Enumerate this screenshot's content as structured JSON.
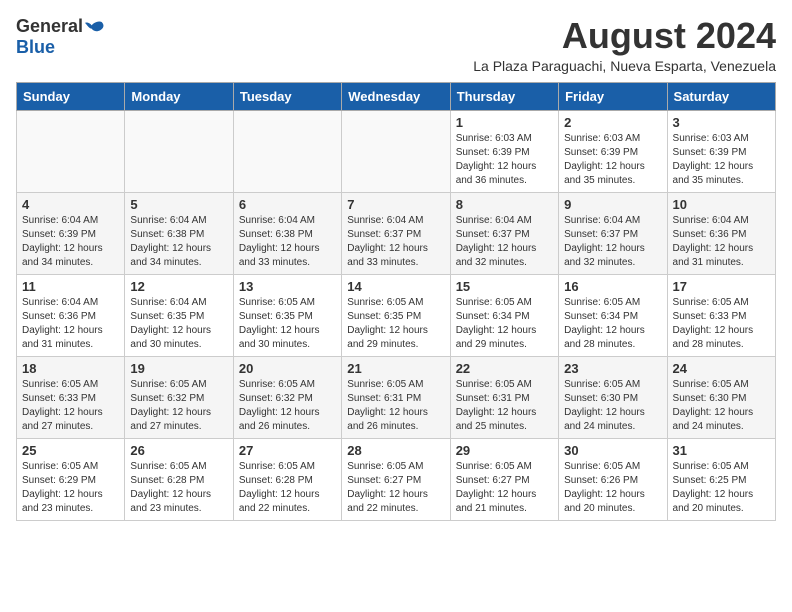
{
  "header": {
    "logo_general": "General",
    "logo_blue": "Blue",
    "month_title": "August 2024",
    "subtitle": "La Plaza Paraguachi, Nueva Esparta, Venezuela"
  },
  "weekdays": [
    "Sunday",
    "Monday",
    "Tuesday",
    "Wednesday",
    "Thursday",
    "Friday",
    "Saturday"
  ],
  "weeks": [
    [
      {
        "day": "",
        "info": ""
      },
      {
        "day": "",
        "info": ""
      },
      {
        "day": "",
        "info": ""
      },
      {
        "day": "",
        "info": ""
      },
      {
        "day": "1",
        "info": "Sunrise: 6:03 AM\nSunset: 6:39 PM\nDaylight: 12 hours\nand 36 minutes."
      },
      {
        "day": "2",
        "info": "Sunrise: 6:03 AM\nSunset: 6:39 PM\nDaylight: 12 hours\nand 35 minutes."
      },
      {
        "day": "3",
        "info": "Sunrise: 6:03 AM\nSunset: 6:39 PM\nDaylight: 12 hours\nand 35 minutes."
      }
    ],
    [
      {
        "day": "4",
        "info": "Sunrise: 6:04 AM\nSunset: 6:39 PM\nDaylight: 12 hours\nand 34 minutes."
      },
      {
        "day": "5",
        "info": "Sunrise: 6:04 AM\nSunset: 6:38 PM\nDaylight: 12 hours\nand 34 minutes."
      },
      {
        "day": "6",
        "info": "Sunrise: 6:04 AM\nSunset: 6:38 PM\nDaylight: 12 hours\nand 33 minutes."
      },
      {
        "day": "7",
        "info": "Sunrise: 6:04 AM\nSunset: 6:37 PM\nDaylight: 12 hours\nand 33 minutes."
      },
      {
        "day": "8",
        "info": "Sunrise: 6:04 AM\nSunset: 6:37 PM\nDaylight: 12 hours\nand 32 minutes."
      },
      {
        "day": "9",
        "info": "Sunrise: 6:04 AM\nSunset: 6:37 PM\nDaylight: 12 hours\nand 32 minutes."
      },
      {
        "day": "10",
        "info": "Sunrise: 6:04 AM\nSunset: 6:36 PM\nDaylight: 12 hours\nand 31 minutes."
      }
    ],
    [
      {
        "day": "11",
        "info": "Sunrise: 6:04 AM\nSunset: 6:36 PM\nDaylight: 12 hours\nand 31 minutes."
      },
      {
        "day": "12",
        "info": "Sunrise: 6:04 AM\nSunset: 6:35 PM\nDaylight: 12 hours\nand 30 minutes."
      },
      {
        "day": "13",
        "info": "Sunrise: 6:05 AM\nSunset: 6:35 PM\nDaylight: 12 hours\nand 30 minutes."
      },
      {
        "day": "14",
        "info": "Sunrise: 6:05 AM\nSunset: 6:35 PM\nDaylight: 12 hours\nand 29 minutes."
      },
      {
        "day": "15",
        "info": "Sunrise: 6:05 AM\nSunset: 6:34 PM\nDaylight: 12 hours\nand 29 minutes."
      },
      {
        "day": "16",
        "info": "Sunrise: 6:05 AM\nSunset: 6:34 PM\nDaylight: 12 hours\nand 28 minutes."
      },
      {
        "day": "17",
        "info": "Sunrise: 6:05 AM\nSunset: 6:33 PM\nDaylight: 12 hours\nand 28 minutes."
      }
    ],
    [
      {
        "day": "18",
        "info": "Sunrise: 6:05 AM\nSunset: 6:33 PM\nDaylight: 12 hours\nand 27 minutes."
      },
      {
        "day": "19",
        "info": "Sunrise: 6:05 AM\nSunset: 6:32 PM\nDaylight: 12 hours\nand 27 minutes."
      },
      {
        "day": "20",
        "info": "Sunrise: 6:05 AM\nSunset: 6:32 PM\nDaylight: 12 hours\nand 26 minutes."
      },
      {
        "day": "21",
        "info": "Sunrise: 6:05 AM\nSunset: 6:31 PM\nDaylight: 12 hours\nand 26 minutes."
      },
      {
        "day": "22",
        "info": "Sunrise: 6:05 AM\nSunset: 6:31 PM\nDaylight: 12 hours\nand 25 minutes."
      },
      {
        "day": "23",
        "info": "Sunrise: 6:05 AM\nSunset: 6:30 PM\nDaylight: 12 hours\nand 24 minutes."
      },
      {
        "day": "24",
        "info": "Sunrise: 6:05 AM\nSunset: 6:30 PM\nDaylight: 12 hours\nand 24 minutes."
      }
    ],
    [
      {
        "day": "25",
        "info": "Sunrise: 6:05 AM\nSunset: 6:29 PM\nDaylight: 12 hours\nand 23 minutes."
      },
      {
        "day": "26",
        "info": "Sunrise: 6:05 AM\nSunset: 6:28 PM\nDaylight: 12 hours\nand 23 minutes."
      },
      {
        "day": "27",
        "info": "Sunrise: 6:05 AM\nSunset: 6:28 PM\nDaylight: 12 hours\nand 22 minutes."
      },
      {
        "day": "28",
        "info": "Sunrise: 6:05 AM\nSunset: 6:27 PM\nDaylight: 12 hours\nand 22 minutes."
      },
      {
        "day": "29",
        "info": "Sunrise: 6:05 AM\nSunset: 6:27 PM\nDaylight: 12 hours\nand 21 minutes."
      },
      {
        "day": "30",
        "info": "Sunrise: 6:05 AM\nSunset: 6:26 PM\nDaylight: 12 hours\nand 20 minutes."
      },
      {
        "day": "31",
        "info": "Sunrise: 6:05 AM\nSunset: 6:25 PM\nDaylight: 12 hours\nand 20 minutes."
      }
    ]
  ]
}
